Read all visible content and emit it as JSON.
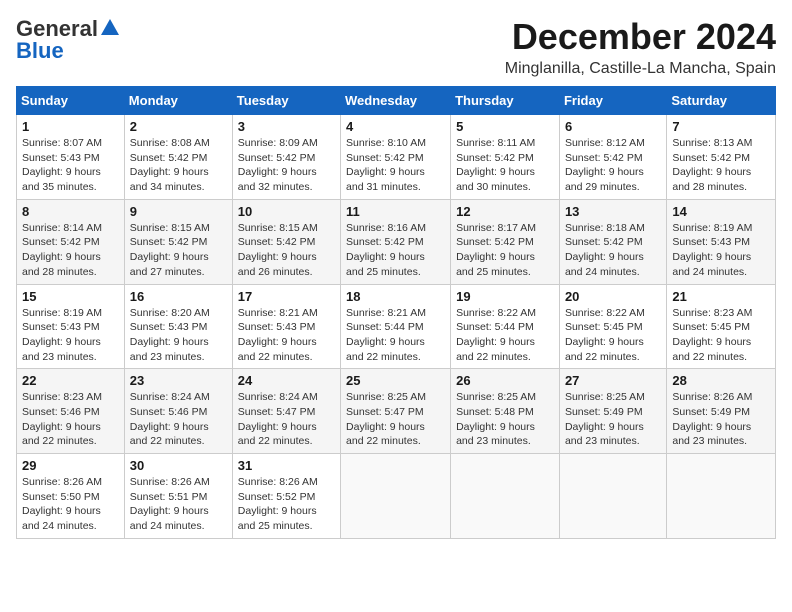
{
  "header": {
    "logo_general": "General",
    "logo_blue": "Blue",
    "month_year": "December 2024",
    "location": "Minglanilla, Castille-La Mancha, Spain"
  },
  "weekdays": [
    "Sunday",
    "Monday",
    "Tuesday",
    "Wednesday",
    "Thursday",
    "Friday",
    "Saturday"
  ],
  "weeks": [
    [
      {
        "day": "1",
        "info": "Sunrise: 8:07 AM\nSunset: 5:43 PM\nDaylight: 9 hours\nand 35 minutes."
      },
      {
        "day": "2",
        "info": "Sunrise: 8:08 AM\nSunset: 5:42 PM\nDaylight: 9 hours\nand 34 minutes."
      },
      {
        "day": "3",
        "info": "Sunrise: 8:09 AM\nSunset: 5:42 PM\nDaylight: 9 hours\nand 32 minutes."
      },
      {
        "day": "4",
        "info": "Sunrise: 8:10 AM\nSunset: 5:42 PM\nDaylight: 9 hours\nand 31 minutes."
      },
      {
        "day": "5",
        "info": "Sunrise: 8:11 AM\nSunset: 5:42 PM\nDaylight: 9 hours\nand 30 minutes."
      },
      {
        "day": "6",
        "info": "Sunrise: 8:12 AM\nSunset: 5:42 PM\nDaylight: 9 hours\nand 29 minutes."
      },
      {
        "day": "7",
        "info": "Sunrise: 8:13 AM\nSunset: 5:42 PM\nDaylight: 9 hours\nand 28 minutes."
      }
    ],
    [
      {
        "day": "8",
        "info": "Sunrise: 8:14 AM\nSunset: 5:42 PM\nDaylight: 9 hours\nand 28 minutes."
      },
      {
        "day": "9",
        "info": "Sunrise: 8:15 AM\nSunset: 5:42 PM\nDaylight: 9 hours\nand 27 minutes."
      },
      {
        "day": "10",
        "info": "Sunrise: 8:15 AM\nSunset: 5:42 PM\nDaylight: 9 hours\nand 26 minutes."
      },
      {
        "day": "11",
        "info": "Sunrise: 8:16 AM\nSunset: 5:42 PM\nDaylight: 9 hours\nand 25 minutes."
      },
      {
        "day": "12",
        "info": "Sunrise: 8:17 AM\nSunset: 5:42 PM\nDaylight: 9 hours\nand 25 minutes."
      },
      {
        "day": "13",
        "info": "Sunrise: 8:18 AM\nSunset: 5:42 PM\nDaylight: 9 hours\nand 24 minutes."
      },
      {
        "day": "14",
        "info": "Sunrise: 8:19 AM\nSunset: 5:43 PM\nDaylight: 9 hours\nand 24 minutes."
      }
    ],
    [
      {
        "day": "15",
        "info": "Sunrise: 8:19 AM\nSunset: 5:43 PM\nDaylight: 9 hours\nand 23 minutes."
      },
      {
        "day": "16",
        "info": "Sunrise: 8:20 AM\nSunset: 5:43 PM\nDaylight: 9 hours\nand 23 minutes."
      },
      {
        "day": "17",
        "info": "Sunrise: 8:21 AM\nSunset: 5:43 PM\nDaylight: 9 hours\nand 22 minutes."
      },
      {
        "day": "18",
        "info": "Sunrise: 8:21 AM\nSunset: 5:44 PM\nDaylight: 9 hours\nand 22 minutes."
      },
      {
        "day": "19",
        "info": "Sunrise: 8:22 AM\nSunset: 5:44 PM\nDaylight: 9 hours\nand 22 minutes."
      },
      {
        "day": "20",
        "info": "Sunrise: 8:22 AM\nSunset: 5:45 PM\nDaylight: 9 hours\nand 22 minutes."
      },
      {
        "day": "21",
        "info": "Sunrise: 8:23 AM\nSunset: 5:45 PM\nDaylight: 9 hours\nand 22 minutes."
      }
    ],
    [
      {
        "day": "22",
        "info": "Sunrise: 8:23 AM\nSunset: 5:46 PM\nDaylight: 9 hours\nand 22 minutes."
      },
      {
        "day": "23",
        "info": "Sunrise: 8:24 AM\nSunset: 5:46 PM\nDaylight: 9 hours\nand 22 minutes."
      },
      {
        "day": "24",
        "info": "Sunrise: 8:24 AM\nSunset: 5:47 PM\nDaylight: 9 hours\nand 22 minutes."
      },
      {
        "day": "25",
        "info": "Sunrise: 8:25 AM\nSunset: 5:47 PM\nDaylight: 9 hours\nand 22 minutes."
      },
      {
        "day": "26",
        "info": "Sunrise: 8:25 AM\nSunset: 5:48 PM\nDaylight: 9 hours\nand 23 minutes."
      },
      {
        "day": "27",
        "info": "Sunrise: 8:25 AM\nSunset: 5:49 PM\nDaylight: 9 hours\nand 23 minutes."
      },
      {
        "day": "28",
        "info": "Sunrise: 8:26 AM\nSunset: 5:49 PM\nDaylight: 9 hours\nand 23 minutes."
      }
    ],
    [
      {
        "day": "29",
        "info": "Sunrise: 8:26 AM\nSunset: 5:50 PM\nDaylight: 9 hours\nand 24 minutes."
      },
      {
        "day": "30",
        "info": "Sunrise: 8:26 AM\nSunset: 5:51 PM\nDaylight: 9 hours\nand 24 minutes."
      },
      {
        "day": "31",
        "info": "Sunrise: 8:26 AM\nSunset: 5:52 PM\nDaylight: 9 hours\nand 25 minutes."
      },
      {
        "day": "",
        "info": ""
      },
      {
        "day": "",
        "info": ""
      },
      {
        "day": "",
        "info": ""
      },
      {
        "day": "",
        "info": ""
      }
    ]
  ]
}
